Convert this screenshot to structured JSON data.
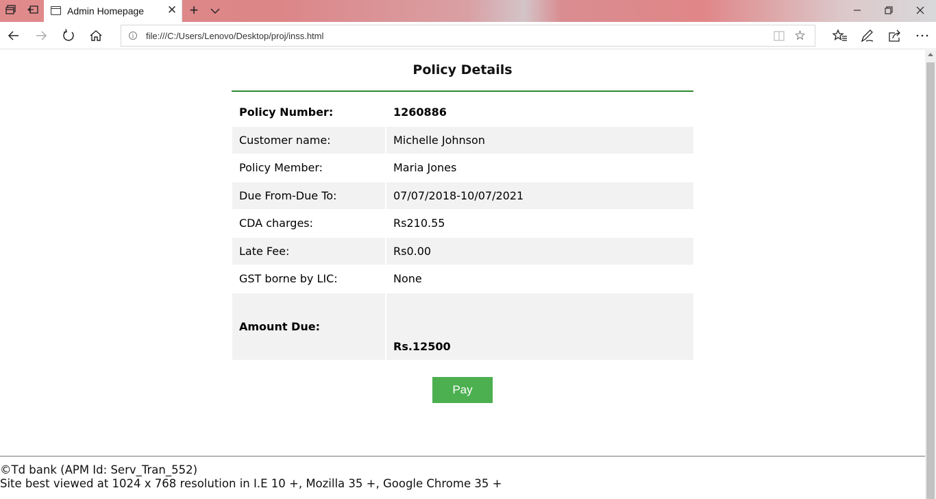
{
  "browser": {
    "tab_title": "Admin Homepage",
    "url": "file:///C:/Users/Lenovo/Desktop/proj/inss.html",
    "icons": [
      "tab-actions-icon",
      "set-aside-tabs-icon",
      "page-icon",
      "close-icon",
      "new-tab-icon",
      "chevron-down-icon",
      "back-icon",
      "forward-icon",
      "refresh-icon",
      "home-icon",
      "info-icon",
      "reading-view-icon",
      "favorite-star-icon",
      "favorites-list-icon",
      "pen-icon",
      "share-icon",
      "more-icon",
      "minimize-icon",
      "restore-icon",
      "window-close-icon"
    ]
  },
  "page": {
    "heading": "Policy Details",
    "accent_color": "#2e8b2e",
    "button_color": "#4caf50",
    "rows": [
      {
        "label": "Policy Number:",
        "value": "1260886"
      },
      {
        "label": "Customer name:",
        "value": "Michelle Johnson"
      },
      {
        "label": "Policy Member:",
        "value": "Maria Jones"
      },
      {
        "label": "Due From-Due To:",
        "value": "07/07/2018-10/07/2021"
      },
      {
        "label": "CDA charges:",
        "value": "Rs210.55"
      },
      {
        "label": "Late Fee:",
        "value": "Rs0.00"
      },
      {
        "label": "GST borne by LIC:",
        "value": "None"
      },
      {
        "label": "Amount Due:",
        "value": "Rs.12500"
      }
    ],
    "pay_label": "Pay"
  },
  "footer": {
    "line1": "©Td bank (APM Id: Serv_Tran_552)",
    "line2": "Site best viewed at 1024 x 768 resolution in I.E 10 +, Mozilla 35 +, Google Chrome 35 +"
  }
}
